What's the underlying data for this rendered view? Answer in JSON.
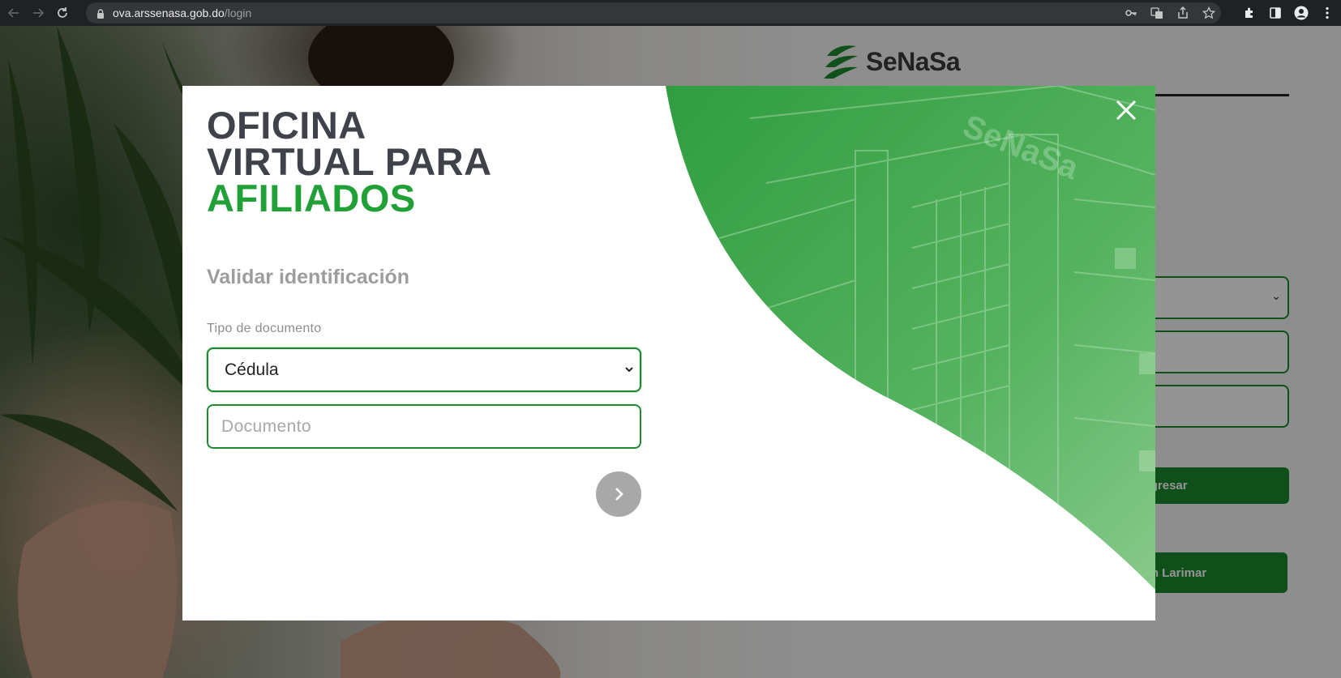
{
  "browser": {
    "url_host": "ova.arssenasa.gob.do",
    "url_path": "/login",
    "icons": [
      "back-arrow-icon",
      "forward-arrow-icon",
      "reload-icon",
      "lock-icon",
      "key-icon",
      "translate-icon",
      "share-icon",
      "star-icon",
      "extensions-icon",
      "sidepanel-icon",
      "profile-icon",
      "menu-icon"
    ]
  },
  "background": {
    "logo_text": "SeNaSa",
    "ingresar_label": "Ingresar",
    "plan_label": "a! Plan Larimar"
  },
  "modal": {
    "title_line1": "OFICINA",
    "title_line2": "VIRTUAL PARA",
    "title_line3": "AFILIADOS",
    "section_title": "Validar identificación",
    "doc_type_label": "Tipo de documento",
    "doc_type_selected": "Cédula",
    "document_placeholder": "Documento",
    "next_icon": "chevron-right-icon",
    "close_icon": "close-icon"
  },
  "colors": {
    "brand_green": "#21a038",
    "border_green": "#1d8a2f",
    "title_dark": "#3f4249",
    "muted_gray": "#9d9d9d",
    "button_gray": "#a8a8a8"
  }
}
